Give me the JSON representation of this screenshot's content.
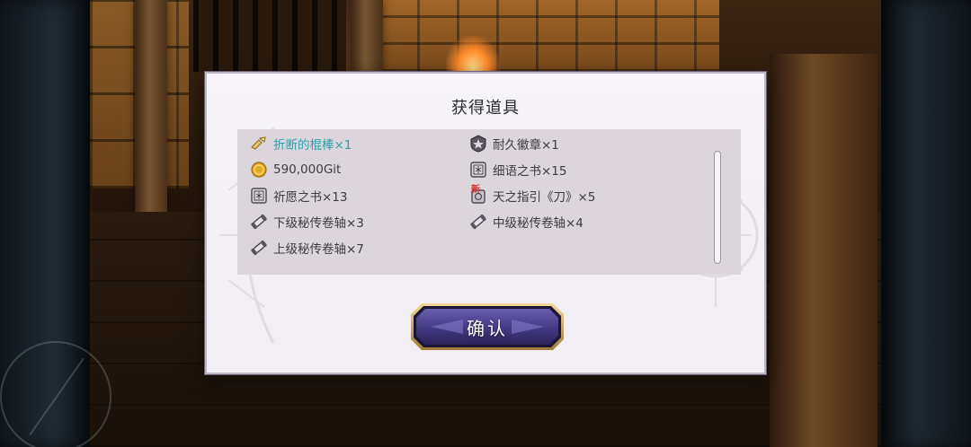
{
  "dialog": {
    "title": "获得道具",
    "confirm_label": "确认"
  },
  "items": [
    {
      "label": "折断的棍棒×1",
      "icon": "broken-club-icon",
      "highlight": true
    },
    {
      "label": "耐久徽章×1",
      "icon": "durability-badge-icon"
    },
    {
      "label": "590,000Git",
      "icon": "gold-coin-icon"
    },
    {
      "label": "细语之书×15",
      "icon": "book-icon"
    },
    {
      "label": "祈愿之书×13",
      "icon": "book-icon"
    },
    {
      "label": "天之指引《刀》×5",
      "icon": "guidance-tome-icon",
      "badge": "新"
    },
    {
      "label": "下级秘传卷轴×3",
      "icon": "scroll-icon"
    },
    {
      "label": "中级秘传卷轴×4",
      "icon": "scroll-icon"
    },
    {
      "label": "上级秘传卷轴×7",
      "icon": "scroll-icon"
    }
  ],
  "colors": {
    "highlight_text": "#2f9ea8",
    "panel_bg": "#dcd6dc",
    "button_fill": "#4a3f8a",
    "button_border": "#c9a864",
    "new_badge": "#d63030"
  }
}
